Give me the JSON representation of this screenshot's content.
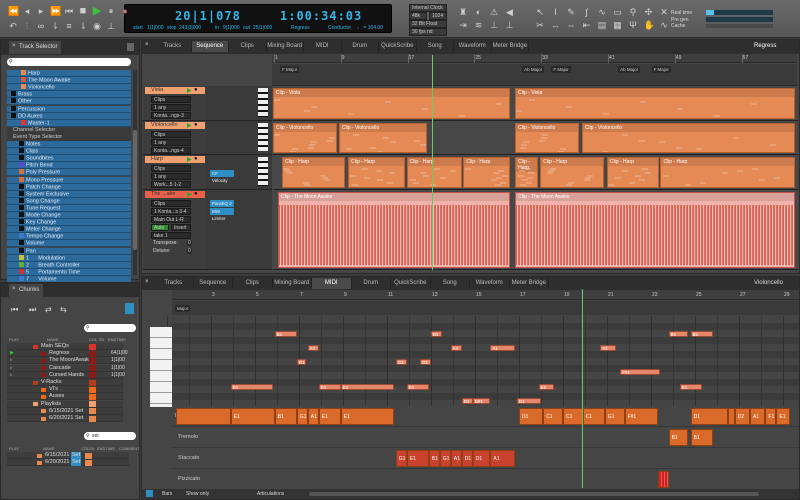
{
  "colors": {
    "accent": "#2fb6ea",
    "track_blue": "#2c6a9c",
    "clip_orange": "#e58a55",
    "audio_pink": "#f0b3ab",
    "legato": "#d96a2a",
    "staccato": "#c9422e",
    "play_green": "#3cc43c"
  },
  "transport": {
    "icons": [
      "rewind-icon",
      "step-back-icon",
      "step-forward-icon",
      "fast-forward-icon",
      "return-to-start-icon",
      "stop-icon",
      "play-icon",
      "pause-icon",
      "record-icon",
      "undo-icon",
      "punch-icon",
      "loop-icon",
      "memory-cycle-icon",
      "overdub-icon",
      "auto-rewind-icon",
      "click-icon",
      "countoff-icon"
    ]
  },
  "counter": {
    "bars": "20|1|078",
    "time": "1:00:34:03",
    "start_label": "start",
    "start": "1|1|000",
    "stop_label": "stop",
    "stop": "243|3|000",
    "in_label": "in",
    "in": "9|1|000",
    "out_label": "out",
    "out": "25|1|000",
    "sequence": "Regress",
    "conductor": "Conductor",
    "tempo": "♩ = 104.00"
  },
  "clock": {
    "source": "Internal Clock",
    "rate": "48k",
    "buffer": "1024",
    "format": "32 Bit Float",
    "fps": "30 fps nd"
  },
  "meters": {
    "real_time": "Real time",
    "pre_gen": "Pre gen",
    "cache": "Cache",
    "real_time_level": 0.12
  },
  "track_selector": {
    "title": "Track Selector",
    "items": [
      {
        "label": "Harp",
        "color": "#e58a55"
      },
      {
        "label": "The Moon Awake",
        "color": "#e0553a"
      },
      {
        "label": "Violoncello",
        "color": "#e58a55"
      },
      {
        "label": "Brass",
        "color": "#111"
      },
      {
        "label": "Other",
        "color": "#111"
      },
      {
        "label": "Percussion",
        "color": "#111"
      },
      {
        "label": "DD Auxes",
        "color": "#111"
      },
      {
        "label": "Master-1",
        "color": "#d33"
      }
    ],
    "channel_selector": "Channel Selector",
    "event_type_selector": "Event Type Selector",
    "events": [
      {
        "label": "Notes",
        "color": "#111"
      },
      {
        "label": "Clips",
        "color": "#111"
      },
      {
        "label": "Soundbites",
        "color": "#111"
      },
      {
        "label": "Pitch Bend",
        "color": "#5a4ad0"
      },
      {
        "label": "Poly Pressure",
        "color": "#d0703a"
      },
      {
        "label": "Mono Pressure",
        "color": "#d0703a"
      },
      {
        "label": "Patch Change",
        "color": "#111"
      },
      {
        "label": "System Exclusive",
        "color": "#111"
      },
      {
        "label": "Song Change",
        "color": "#111"
      },
      {
        "label": "Tune Request",
        "color": "#111"
      },
      {
        "label": "Mode Change",
        "color": "#111"
      },
      {
        "label": "Key Change",
        "color": "#111"
      },
      {
        "label": "Meter Change",
        "color": "#111"
      },
      {
        "label": "Tempo Change",
        "color": "#3a7ad0"
      },
      {
        "label": "Volume",
        "color": "#111"
      },
      {
        "label": "Pan",
        "color": "#111"
      },
      {
        "label": "1      Modulation",
        "color": "#c8c030"
      },
      {
        "label": "2      Breath Controller",
        "color": "#5ab030"
      },
      {
        "label": "5      Portamento Time",
        "color": "#d03030"
      },
      {
        "label": "7      Volume",
        "color": "#3a7ad0"
      }
    ]
  },
  "chunks": {
    "title": "Chunks",
    "cols": [
      "PLAY",
      "NAME",
      "COL",
      "SX",
      "ENDTIME"
    ],
    "rows": [
      {
        "name": "Main SEQs",
        "indent": 1,
        "col": "#d8352a",
        "end": ""
      },
      {
        "name": "Regress",
        "indent": 2,
        "col": "#8a1a1a",
        "end": "64|1|00",
        "play": "▶"
      },
      {
        "name": "The Moon/Awake",
        "indent": 2,
        "col": "#8a1a1a",
        "end": "1|1|00",
        "play": "▹"
      },
      {
        "name": "Cascade",
        "indent": 2,
        "col": "#8a1a1a",
        "end": "1|1|00",
        "play": "▹"
      },
      {
        "name": "Cursed Hands",
        "indent": 2,
        "col": "#8a1a1a",
        "end": "1|1|00",
        "play": "▹"
      },
      {
        "name": "V-Racks",
        "indent": 1,
        "col": "#b33a1a",
        "end": ""
      },
      {
        "name": "VI's",
        "indent": 2,
        "col": "#f06a1a",
        "end": ""
      },
      {
        "name": "Auxes",
        "indent": 2,
        "col": "#f06a1a",
        "end": ""
      },
      {
        "name": "Playlists",
        "indent": 1,
        "col": "#f0a070",
        "end": ""
      },
      {
        "name": "6/15/2021 Set",
        "indent": 2,
        "col": "#e88a50",
        "end": ""
      },
      {
        "name": "6/20/2021 Set",
        "indent": 2,
        "col": "#e88a50",
        "end": ""
      }
    ],
    "search_value": "set",
    "result_cols": [
      "PLAY",
      "NAME",
      "COL",
      "SX",
      "ENDTIME",
      "COMMENT"
    ],
    "results": [
      {
        "name": "6/15/2021",
        "tag": "Set"
      },
      {
        "name": "6/20/2021",
        "tag": "Set"
      }
    ]
  },
  "tabs": [
    "Tracks",
    "Sequence",
    "Clips",
    "Mixing Board",
    "MIDI",
    "Drum",
    "QuickScribe",
    "Song",
    "Waveform",
    "Meter Bridge"
  ],
  "sequence": {
    "active_tab": 1,
    "menu": "Regress",
    "bars": [
      1,
      9,
      17,
      25,
      33,
      41,
      49,
      57
    ],
    "playhead_bar": 20,
    "markers": [
      {
        "bar": 1,
        "label": "F Major"
      },
      {
        "bar": 30,
        "label": "Ab Major"
      },
      {
        "bar": 33.5,
        "label": "F Major"
      },
      {
        "bar": 41.5,
        "label": "Ab Major"
      },
      {
        "bar": 45.5,
        "label": "F Major"
      }
    ],
    "tracks": [
      {
        "name": "Viola",
        "fields": [
          "Clips",
          "1 any",
          "Konta...ngs-3"
        ],
        "inserts": [],
        "clip_label": "Clip - Viola",
        "clips": [
          [
            1,
            29.4
          ],
          [
            30,
            63.5
          ]
        ]
      },
      {
        "name": "Violoncello",
        "fields": [
          "Clips",
          "1 any",
          "Konta...ngs-4"
        ],
        "inserts": [],
        "clip_label": "Clip - Violoncello",
        "clips": [
          [
            1,
            8.7
          ],
          [
            8.9,
            19.5
          ],
          [
            30,
            37.7
          ],
          [
            38,
            63.5
          ]
        ]
      },
      {
        "name": "Harp",
        "fields": [
          "Clips",
          "1 any",
          "Work...5 1-2"
        ],
        "inserts": [
          "CF Velocity"
        ],
        "clip_label": "Clip - Harp",
        "clips": [
          [
            2.1,
            9.6
          ],
          [
            10,
            16.8
          ],
          [
            17,
            23.6
          ],
          [
            23.8,
            29.4
          ],
          [
            30,
            32.7
          ],
          [
            33,
            40.7
          ],
          [
            41,
            47.2
          ],
          [
            47.4,
            63.5
          ]
        ]
      },
      {
        "name": "The ...ake",
        "fields": [
          "Clips",
          "1 Konta...s 3-4",
          "Main Out L-R",
          "take 1"
        ],
        "auto": "Auto",
        "insert_mode": "Insert",
        "transpose_label": "Transpose:",
        "transpose": "0",
        "detune_label": "Detune:",
        "detune": "0",
        "inserts": [
          "ParaEQ 2",
          "MW Limiter"
        ],
        "clip_label": "Clip - The Moon Awake",
        "clips": [
          [
            1.6,
            29.4
          ],
          [
            30,
            63.5
          ]
        ],
        "audio": true
      }
    ]
  },
  "midi": {
    "active_tab": 4,
    "track_menu": "Violoncello",
    "bars": [
      3,
      5,
      7,
      9,
      11,
      13,
      15,
      17,
      19,
      21,
      23,
      25,
      27,
      29
    ],
    "playhead_bar": 19.9,
    "key_marker": "Major",
    "notes": [
      {
        "p": "B1",
        "s": 5.9,
        "e": 6.9
      },
      {
        "p": "B1",
        "s": 13,
        "e": 13.5
      },
      {
        "p": "A1",
        "s": 7.4,
        "e": 7.9
      },
      {
        "p": "A1",
        "s": 13.9,
        "e": 14.4
      },
      {
        "p": "A1",
        "s": 15.7,
        "e": 16.8
      },
      {
        "p": "G1",
        "s": 6.9,
        "e": 7.3
      },
      {
        "p": "G1",
        "s": 11.4,
        "e": 11.9
      },
      {
        "p": "G1",
        "s": 12.5,
        "e": 13
      },
      {
        "p": "E1",
        "s": 3.9,
        "e": 5.8
      },
      {
        "p": "E1",
        "s": 7.9,
        "e": 8.9
      },
      {
        "p": "E1",
        "s": 8.9,
        "e": 11.3
      },
      {
        "p": "E1",
        "s": 11.9,
        "e": 12.9
      },
      {
        "p": "E1",
        "s": 17.9,
        "e": 18.6
      },
      {
        "p": "D1",
        "s": 14.4,
        "e": 14.9
      },
      {
        "p": "D#1",
        "s": 14.9,
        "e": 15.7
      },
      {
        "p": "D1",
        "s": 16.9,
        "e": 18
      },
      {
        "p": "F#1",
        "s": 21.6,
        "e": 23.4
      },
      {
        "p": "B1",
        "s": 23.8,
        "e": 24.7
      },
      {
        "p": "B1",
        "s": 24.8,
        "e": 25.8
      },
      {
        "p": "A1",
        "s": 20.7,
        "e": 21.4
      },
      {
        "p": "E1",
        "s": 24.3,
        "e": 25.3
      }
    ],
    "lanes": [
      {
        "name": "Legato",
        "notes": [
          {
            "p": "",
            "s": 1.4,
            "e": 3.9
          },
          {
            "p": "E1",
            "s": 3.9,
            "e": 5.9
          },
          {
            "p": "B1",
            "s": 5.9,
            "e": 6.9
          },
          {
            "p": "G1",
            "s": 6.9,
            "e": 7.4
          },
          {
            "p": "A1",
            "s": 7.4,
            "e": 7.9
          },
          {
            "p": "E1",
            "s": 7.9,
            "e": 8.9
          },
          {
            "p": "E1",
            "s": 8.9,
            "e": 11.3
          },
          {
            "p": "D1",
            "s": 17,
            "e": 18.1
          },
          {
            "p": "C1",
            "s": 18.1,
            "e": 19
          },
          {
            "p": "C1",
            "s": 19,
            "e": 19.9
          },
          {
            "p": "C1",
            "s": 19.9,
            "e": 20.9
          },
          {
            "p": "G1",
            "s": 20.9,
            "e": 21.8
          },
          {
            "p": "F#1",
            "s": 21.8,
            "e": 23.3
          },
          {
            "p": "D1",
            "s": 24.8,
            "e": 26.5
          },
          {
            "p": "",
            "s": 26.5,
            "e": 26.8
          },
          {
            "p": "D2",
            "s": 26.8,
            "e": 27.5
          },
          {
            "p": "A1",
            "s": 27.5,
            "e": 28.2
          },
          {
            "p": "F1",
            "s": 28.2,
            "e": 28.7
          },
          {
            "p": "E1",
            "s": 28.7,
            "e": 29.3
          }
        ]
      },
      {
        "name": "Tremolo",
        "notes": [
          {
            "p": "B1",
            "s": 23.8,
            "e": 24.7
          },
          {
            "p": "B1",
            "s": 24.8,
            "e": 25.8
          }
        ]
      },
      {
        "name": "Staccato",
        "notes": [
          {
            "p": "G1",
            "s": 11.4,
            "e": 11.9
          },
          {
            "p": "E1",
            "s": 11.9,
            "e": 12.9
          },
          {
            "p": "B1",
            "s": 12.9,
            "e": 13.4
          },
          {
            "p": "G1",
            "s": 13.4,
            "e": 13.9
          },
          {
            "p": "A1",
            "s": 13.9,
            "e": 14.4
          },
          {
            "p": "D1",
            "s": 14.4,
            "e": 14.9
          },
          {
            "p": "D1",
            "s": 14.9,
            "e": 15.7
          },
          {
            "p": "A1",
            "s": 15.7,
            "e": 16.8
          }
        ]
      },
      {
        "name": "Pizzicato",
        "notes": [
          {
            "p": "",
            "s": 23.3,
            "e": 23.8
          }
        ]
      }
    ],
    "bottom": {
      "bars": "Bars",
      "show_only": "Show only",
      "articulations": "Articulations"
    }
  }
}
